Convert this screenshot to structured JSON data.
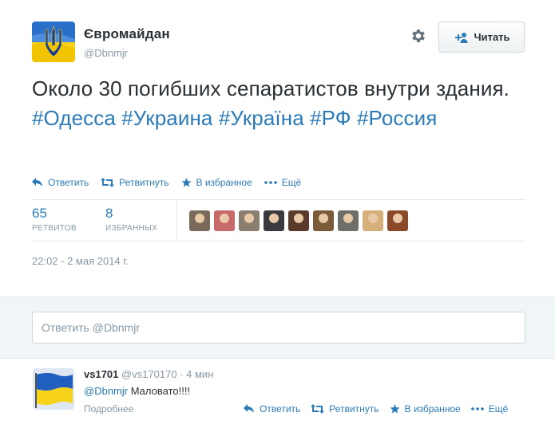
{
  "tweet": {
    "display_name": "Євромайдан",
    "screen_name": "@Dbnmjr",
    "follow_label": "Читать",
    "text_plain": "Около 30 погибших сепаратистов внутри здания. ",
    "hashtags": [
      "#Одесса",
      "#Украина",
      "#Україна",
      "#РФ",
      "#Россия"
    ],
    "actions": {
      "reply": "Ответить",
      "retweet": "Ретвитнуть",
      "favorite": "В избранное",
      "more": "Ещё"
    },
    "stats": {
      "retweets_count": "65",
      "retweets_label": "РЕТВИТОВ",
      "favorites_count": "8",
      "favorites_label": "ИЗБРАННЫХ"
    },
    "faces": [
      {
        "name": "face-1",
        "color": "#7a6a5a"
      },
      {
        "name": "face-2",
        "color": "#c96a6a"
      },
      {
        "name": "face-3",
        "color": "#8a7f6e"
      },
      {
        "name": "face-4",
        "color": "#3b3a3f"
      },
      {
        "name": "face-5",
        "color": "#5a3a2a"
      },
      {
        "name": "face-6",
        "color": "#7b5a3a"
      },
      {
        "name": "face-7",
        "color": "#6f6f6a"
      },
      {
        "name": "face-8",
        "color": "#d6b07a"
      },
      {
        "name": "face-9",
        "color": "#8a4a2a"
      }
    ],
    "timestamp": "22:02 - 2 мая 2014 г."
  },
  "reply_box": {
    "placeholder": "Ответить @Dbnmjr"
  },
  "reply": {
    "name": "vs1701",
    "screen_name": "@vs170170",
    "sep": " · ",
    "time": "4 мин",
    "mention": "@Dbnmjr",
    "text": " Маловато!!!!",
    "details_label": "Подробнее",
    "actions": {
      "reply": "Ответить",
      "retweet": "Ретвитнуть",
      "favorite": "В избранное",
      "more": "Ещё"
    }
  },
  "colors": {
    "link": "#2b7bb9",
    "muted": "#8899a6",
    "text": "#292f33",
    "ukraine_blue": "#1f5fbf",
    "ukraine_yellow": "#f7d21b"
  }
}
